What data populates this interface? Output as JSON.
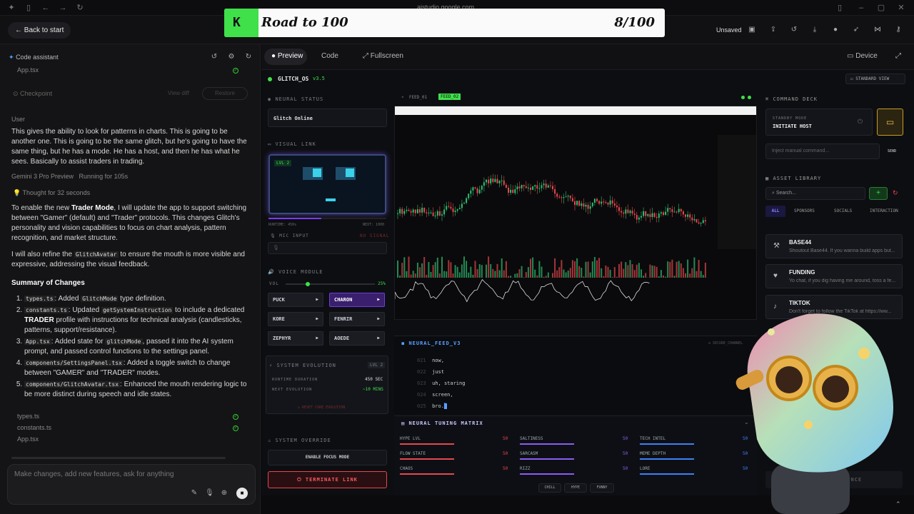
{
  "browser": {
    "url": "aistudio.google.com"
  },
  "header": {
    "back": "Back to start",
    "unsaved": "Unsaved"
  },
  "banner": {
    "k": "K",
    "title": "Road to 100",
    "score": "8/100"
  },
  "left": {
    "assistant": "Code assistant",
    "file_top": "App.tsx",
    "checkpoint": "Checkpoint",
    "view_diff": "View diff",
    "restore": "Restore",
    "user_label": "User",
    "user_msg": "This gives the ability to look for patterns in charts. This is going to be another one. This is going to be the same glitch, but he's going to have the same thing, but he has a mode. He has a host, and then he has what he sees. Basically to assist traders in trading.",
    "model": "Gemini 3 Pro Preview",
    "running": "Running for 105s",
    "thought": "Thought for 32 seconds",
    "p1a": "To enable the new ",
    "p1b": "Trader Mode",
    "p1c": ", I will update the app to support switching between \"Gamer\" (default) and \"Trader\" protocols. This changes Glitch's personality and vision capabilities to focus on chart analysis, pattern recognition, and market structure.",
    "p2a": "I will also refine the ",
    "p2code": "GlitchAvatar",
    "p2b": " to ensure the mouth is more visible and expressive, addressing the visual feedback.",
    "summary": "Summary of Changes",
    "c1code": "types.ts",
    "c1a": ": Added ",
    "c1code2": "GlitchMode",
    "c1b": " type definition.",
    "c2code": "constants.ts",
    "c2a": ": Updated ",
    "c2code2": "getSystemInstruction",
    "c2b": " to include a dedicated ",
    "c2bold": "TRADER",
    "c2c": " profile with instructions for technical analysis (candlesticks, patterns, support/resistance).",
    "c3code": "App.tsx",
    "c3a": ": Added state for ",
    "c3code2": "glitchMode",
    "c3b": ", passed it into the AI system prompt, and passed control functions to the settings panel.",
    "c4code": "components/SettingsPanel.tsx",
    "c4a": ": Added a toggle switch to change between \"GAMER\" and \"TRADER\" modes.",
    "c5code": "components/GlitchAvatar.tsx",
    "c5a": ": Enhanced the mouth rendering logic to be more distinct during speech and idle states.",
    "files": [
      "types.ts",
      "constants.ts",
      "App.tsx"
    ],
    "placeholder": "Make changes, add new features, ask for anything"
  },
  "preview": {
    "preview": "Preview",
    "code": "Code",
    "fullscreen": "Fullscreen",
    "device": "Device"
  },
  "app": {
    "brand": "GLITCH_OS",
    "version": "v3.5",
    "standard_view": "STANDARD VIEW",
    "neural_status": "NEURAL STATUS",
    "status": "Glitch Online",
    "visual_link": "VISUAL LINK",
    "lvl": "LVL 2",
    "runtime": "RUNTIME: 450s",
    "next": "NEXT: 1000",
    "mic_input": "MIC INPUT",
    "no_signal": "NO SIGNAL",
    "voice_module": "VOICE MODULE",
    "vol": "VOL",
    "vol_pct": "25%",
    "voices": [
      "PUCK",
      "CHARON",
      "KORE",
      "FENRIR",
      "ZEPHYR",
      "AOEDE"
    ],
    "evolution": "SYSTEM EVOLUTION",
    "evo_lvl": "LVL 2",
    "runtime_label": "RUNTIME DURATION",
    "runtime_val": "450 SEC",
    "next_label": "NEXT EVOLUTION",
    "next_val": "~10 MINS",
    "reset": "RESET CORE EVOLUTION",
    "override": "SYSTEM OVERRIDE",
    "focus": "ENABLE FOCUS MODE",
    "terminate": "TERMINATE LINK",
    "feed1": "FEED_01",
    "feed2": "FEED_02",
    "neural_feed": "NEURAL_FEED_V3",
    "secure": "SECURE_CHANNEL",
    "feed_lines": [
      {
        "n": "021",
        "t": "now,"
      },
      {
        "n": "022",
        "t": "just"
      },
      {
        "n": "023",
        "t": "uh, staring"
      },
      {
        "n": "024",
        "t": "screen,"
      },
      {
        "n": "025",
        "t": "bro."
      }
    ],
    "matrix": "NEURAL TUNING MATRIX",
    "tuning": [
      {
        "l": "HYPE LVL",
        "v": "50",
        "c": "#e5484d"
      },
      {
        "l": "SALTINESS",
        "v": "50",
        "c": "#8b5cf6"
      },
      {
        "l": "TECH INTEL",
        "v": "50",
        "c": "#3b82f6"
      },
      {
        "l": "FLOW STATE",
        "v": "50",
        "c": "#e5484d"
      },
      {
        "l": "SARCASM",
        "v": "50",
        "c": "#8b5cf6"
      },
      {
        "l": "MEME DEPTH",
        "v": "50",
        "c": "#3b82f6"
      },
      {
        "l": "CHAOS",
        "v": "50",
        "c": "#e5484d"
      },
      {
        "l": "RIZZ",
        "v": "50",
        "c": "#8b5cf6"
      },
      {
        "l": "LORE",
        "v": "50",
        "c": "#3b82f6"
      }
    ],
    "presets": [
      "CHILL",
      "HYPE",
      "FUNNY"
    ],
    "command_deck": "COMMAND DECK",
    "standby": "STANDBY MODE",
    "initiate": "INITIATE HOST",
    "cmd_placeholder": "Inject manual command...",
    "send": "SEND",
    "asset_library": "ASSET LIBRARY",
    "search_placeholder": "Search...",
    "asset_tabs": [
      "ALL",
      "SPONSORS",
      "SOCIALS",
      "INTERACTION"
    ],
    "assets": [
      {
        "n": "BASE44",
        "d": "Shoutout Base44. If you wanna build apps but..."
      },
      {
        "n": "FUNDING",
        "d": "Yo chat, if you dig having me around, toss a fe..."
      },
      {
        "n": "TIKTOK",
        "d": "Don't forget to follow the TikTok at https://ww..."
      }
    ],
    "deploy": "DEPLOY SEQUENCE"
  }
}
